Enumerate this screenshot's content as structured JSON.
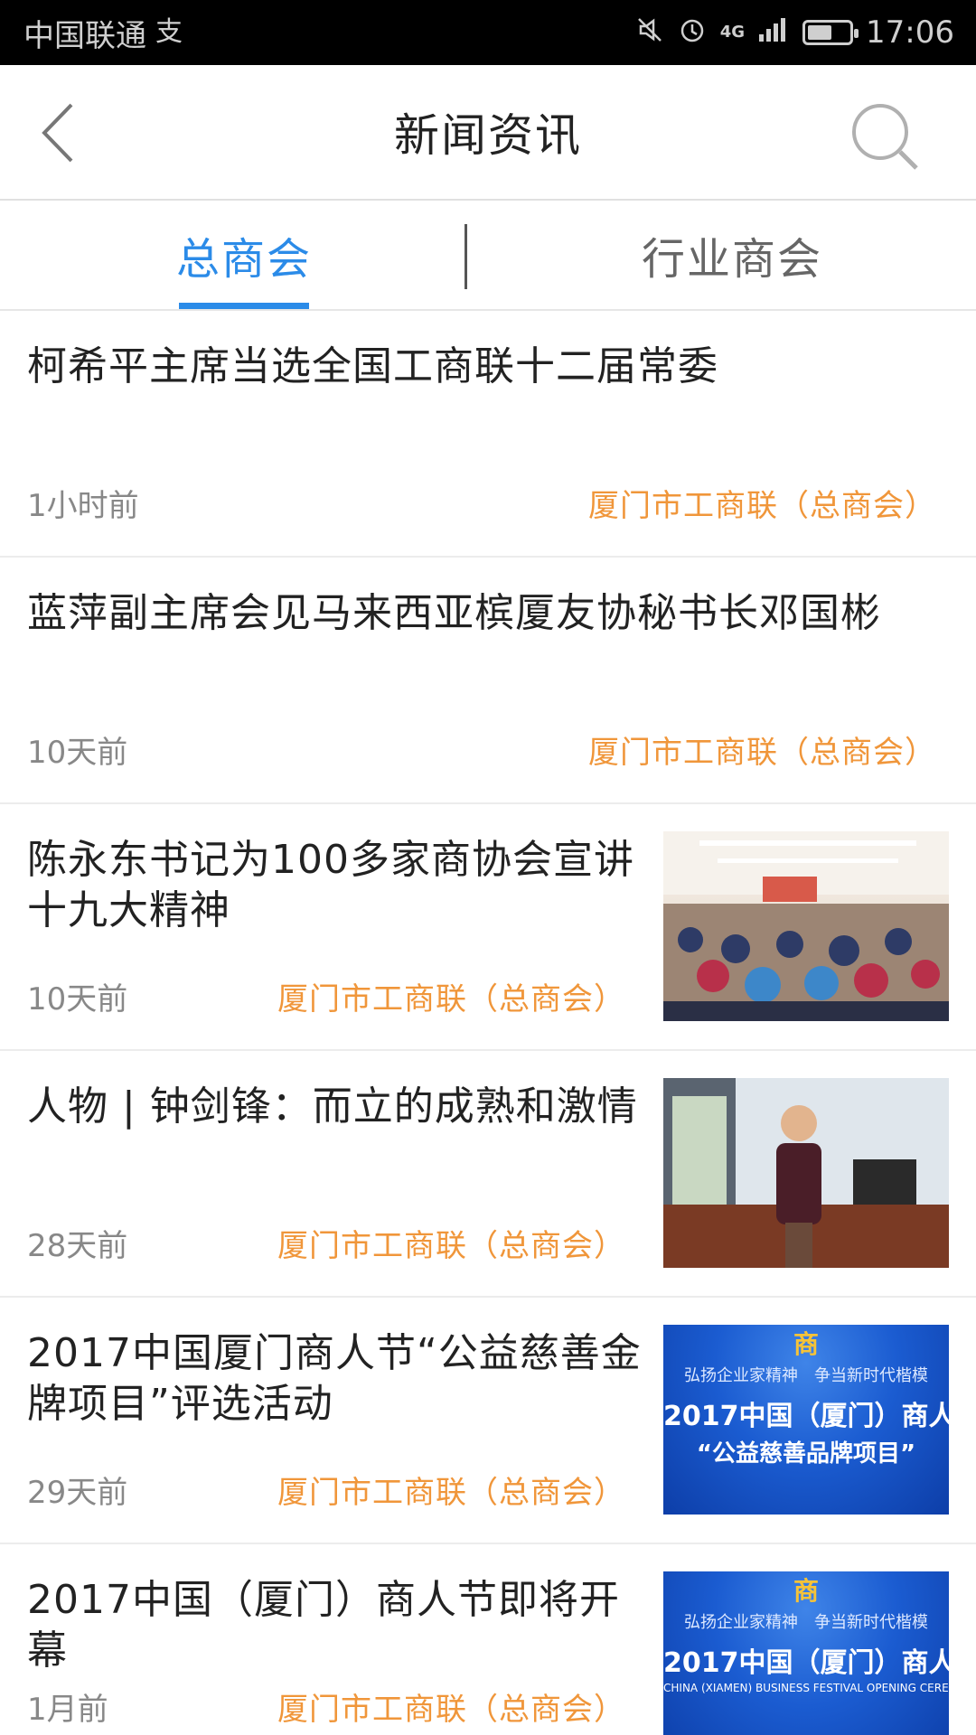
{
  "status_bar": {
    "carrier": "中国联通",
    "extra_icon": "支",
    "network": "4G",
    "time": "17:06",
    "battery_level": 0.6
  },
  "header": {
    "title": "新闻资讯"
  },
  "tabs": [
    {
      "label": "总商会",
      "active": true
    },
    {
      "label": "行业商会",
      "active": false
    }
  ],
  "news": [
    {
      "title": "柯希平主席当选全国工商联十二届常委",
      "time": "1小时前",
      "source": "厦门市工商联（总商会）"
    },
    {
      "title": "蓝萍副主席会见马来西亚槟厦友协秘书长邓国彬",
      "time": "10天前",
      "source": "厦门市工商联（总商会）"
    },
    {
      "title": "陈永东书记为100多家商协会宣讲十九大精神",
      "time": "10天前",
      "source": "厦门市工商联（总商会）"
    },
    {
      "title": "人物 | 钟剑锋：而立的成熟和激情",
      "time": "28天前",
      "source": "厦门市工商联（总商会）"
    },
    {
      "title": "2017中国厦门商人节“公益慈善金牌项目”评选活动",
      "time": "29天前",
      "source": "厦门市工商联（总商会）",
      "thumb": {
        "slogan": "弘扬企业家精神　争当新时代楷模",
        "headline": "2017中国（厦门）商人",
        "sub": "“公益慈善品牌项目”"
      }
    },
    {
      "title": "2017中国（厦门）商人节即将开幕",
      "time": "1月前",
      "source": "厦门市工商联（总商会）",
      "thumb": {
        "slogan": "弘扬企业家精神　争当新时代楷模",
        "headline": "2017中国（厦门）商人",
        "sub": "CHINA (XIAMEN) BUSINESS FESTIVAL OPENING CEREMONY"
      }
    }
  ],
  "colors": {
    "accent": "#2b8be8",
    "source": "#f0963a"
  },
  "icons": {
    "back": "chevron-left-icon",
    "search": "search-icon"
  }
}
